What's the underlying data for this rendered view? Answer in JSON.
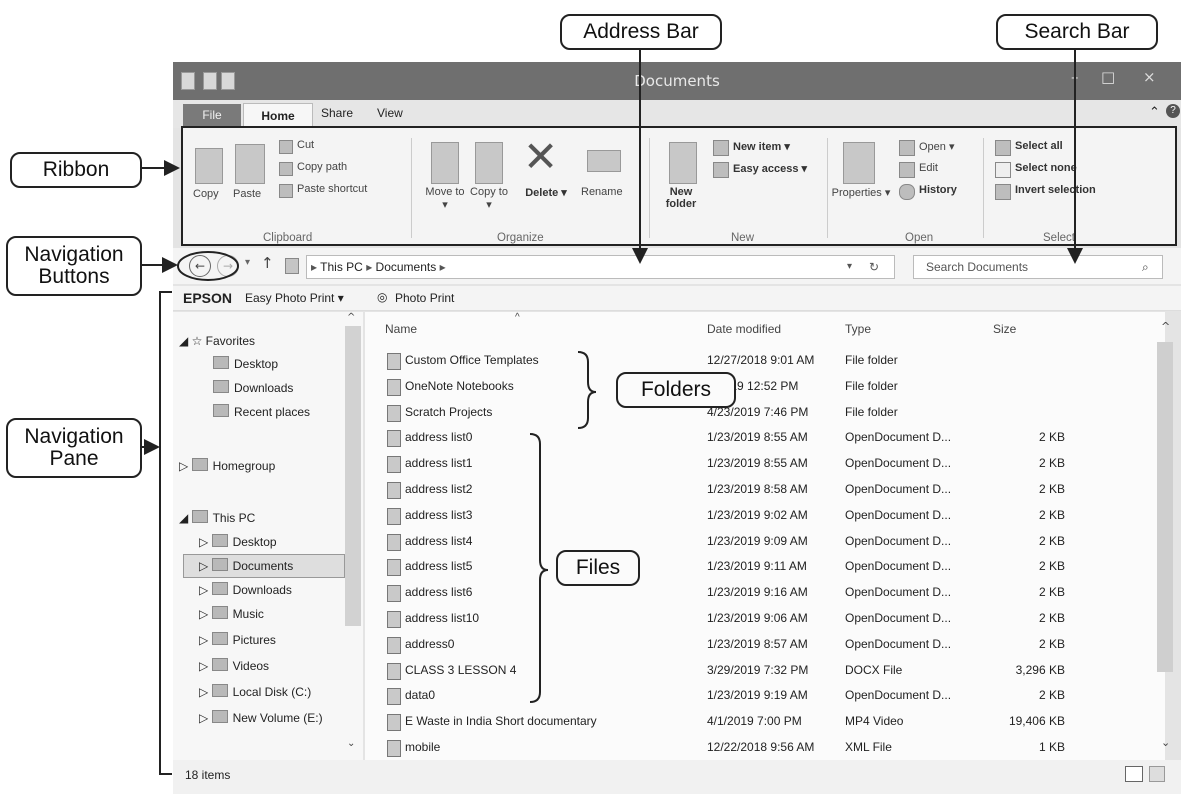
{
  "annotations": {
    "address_bar": "Address Bar",
    "search_bar": "Search Bar",
    "ribbon": "Ribbon",
    "navigation_buttons": "Navigation Buttons",
    "navigation_pane": "Navigation Pane",
    "folders": "Folders",
    "files": "Files"
  },
  "window": {
    "title": "Documents",
    "minimize": "–",
    "maximize": "□",
    "close": "×"
  },
  "tabs": {
    "file": "File",
    "home": "Home",
    "share": "Share",
    "view": "View"
  },
  "ribbon": {
    "clipboard": {
      "group": "Clipboard",
      "copy": "Copy",
      "paste": "Paste",
      "cut": "Cut",
      "copy_path": "Copy path",
      "paste_shortcut": "Paste shortcut"
    },
    "organize": {
      "group": "Organize",
      "move_to": "Move to ▾",
      "copy_to": "Copy to ▾",
      "delete": "Delete ▾",
      "rename": "Rename"
    },
    "new": {
      "group": "New",
      "new_folder": "New folder",
      "new_item": "New item ▾",
      "easy_access": "Easy access ▾"
    },
    "open": {
      "group": "Open",
      "properties": "Properties ▾",
      "open": "Open ▾",
      "edit": "Edit",
      "history": "History"
    },
    "select": {
      "group": "Select",
      "select_all": "Select all",
      "select_none": "Select none",
      "invert_selection": "Invert selection"
    }
  },
  "address": {
    "path": [
      "This PC",
      "Documents"
    ],
    "search_placeholder": "Search Documents"
  },
  "epson": {
    "brand": "EPSON",
    "easy_photo_print": "Easy Photo Print ▾",
    "photo_print": "Photo Print"
  },
  "nav": {
    "favorites": "Favorites",
    "fav_items": [
      "Desktop",
      "Downloads",
      "Recent places"
    ],
    "homegroup": "Homegroup",
    "this_pc": "This PC",
    "pc_items": [
      "Desktop",
      "Documents",
      "Downloads",
      "Music",
      "Pictures",
      "Videos",
      "Local Disk (C:)",
      "New Volume (E:)"
    ]
  },
  "columns": {
    "name": "Name",
    "date": "Date modified",
    "type": "Type",
    "size": "Size"
  },
  "files": [
    {
      "name": "Custom Office Templates",
      "date": "12/27/2018 9:01 AM",
      "type": "File folder",
      "size": ""
    },
    {
      "name": "OneNote Notebooks",
      "date": "7/2019 12:52 PM",
      "type": "File folder",
      "size": ""
    },
    {
      "name": "Scratch Projects",
      "date": "4/23/2019 7:46 PM",
      "type": "File folder",
      "size": ""
    },
    {
      "name": "address list0",
      "date": "1/23/2019 8:55 AM",
      "type": "OpenDocument D...",
      "size": "2 KB"
    },
    {
      "name": "address list1",
      "date": "1/23/2019 8:55 AM",
      "type": "OpenDocument D...",
      "size": "2 KB"
    },
    {
      "name": "address list2",
      "date": "1/23/2019 8:58 AM",
      "type": "OpenDocument D...",
      "size": "2 KB"
    },
    {
      "name": "address list3",
      "date": "1/23/2019 9:02 AM",
      "type": "OpenDocument D...",
      "size": "2 KB"
    },
    {
      "name": "address list4",
      "date": "1/23/2019 9:09 AM",
      "type": "OpenDocument D...",
      "size": "2 KB"
    },
    {
      "name": "address list5",
      "date": "1/23/2019 9:11 AM",
      "type": "OpenDocument D...",
      "size": "2 KB"
    },
    {
      "name": "address list6",
      "date": "1/23/2019 9:16 AM",
      "type": "OpenDocument D...",
      "size": "2 KB"
    },
    {
      "name": "address list10",
      "date": "1/23/2019 9:06 AM",
      "type": "OpenDocument D...",
      "size": "2 KB"
    },
    {
      "name": "address0",
      "date": "1/23/2019 8:57 AM",
      "type": "OpenDocument D...",
      "size": "2 KB"
    },
    {
      "name": "CLASS 3 LESSON 4",
      "date": "3/29/2019 7:32 PM",
      "type": "DOCX File",
      "size": "3,296 KB"
    },
    {
      "name": "data0",
      "date": "1/23/2019 9:19 AM",
      "type": "OpenDocument D...",
      "size": "2 KB"
    },
    {
      "name": "E Waste in India Short documentary",
      "date": "4/1/2019 7:00 PM",
      "type": "MP4 Video",
      "size": "19,406 KB"
    },
    {
      "name": "mobile",
      "date": "12/22/2018 9:56 AM",
      "type": "XML File",
      "size": "1 KB"
    }
  ],
  "status": {
    "items": "18 items"
  }
}
